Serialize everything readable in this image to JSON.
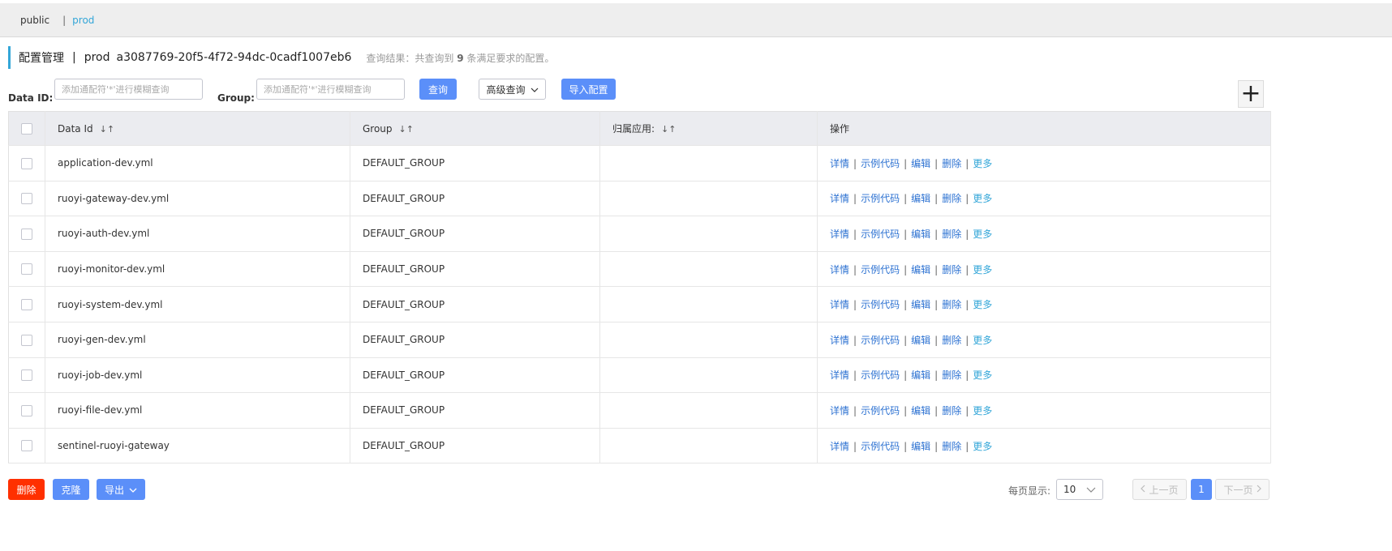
{
  "namespaces": {
    "items": [
      "public",
      "prod"
    ],
    "separator": "|",
    "active": "prod"
  },
  "title": {
    "main": "配置管理",
    "divider": "|",
    "namespace": "prod",
    "namespace_id": "a3087769-20f5-4f72-94dc-0cadf1007eb6",
    "result_prefix": "查询结果：共查询到",
    "result_count": "9",
    "result_suffix": "条满足要求的配置。"
  },
  "search": {
    "dataid_label": "Data ID:",
    "dataid_placeholder": "添加通配符'*'进行模糊查询",
    "group_label": "Group:",
    "group_placeholder": "添加通配符'*'进行模糊查询",
    "query_button": "查询",
    "advanced_button": "高级查询",
    "import_button": "导入配置",
    "add_button": "+"
  },
  "table": {
    "headers": [
      "Data Id",
      "Group",
      "归属应用:",
      "操作"
    ],
    "sort_icon": "↓↑",
    "rows": [
      {
        "data_id": "application-dev.yml",
        "group": "DEFAULT_GROUP",
        "app": ""
      },
      {
        "data_id": "ruoyi-gateway-dev.yml",
        "group": "DEFAULT_GROUP",
        "app": ""
      },
      {
        "data_id": "ruoyi-auth-dev.yml",
        "group": "DEFAULT_GROUP",
        "app": ""
      },
      {
        "data_id": "ruoyi-monitor-dev.yml",
        "group": "DEFAULT_GROUP",
        "app": ""
      },
      {
        "data_id": "ruoyi-system-dev.yml",
        "group": "DEFAULT_GROUP",
        "app": ""
      },
      {
        "data_id": "ruoyi-gen-dev.yml",
        "group": "DEFAULT_GROUP",
        "app": ""
      },
      {
        "data_id": "ruoyi-job-dev.yml",
        "group": "DEFAULT_GROUP",
        "app": ""
      },
      {
        "data_id": "ruoyi-file-dev.yml",
        "group": "DEFAULT_GROUP",
        "app": ""
      },
      {
        "data_id": "sentinel-ruoyi-gateway",
        "group": "DEFAULT_GROUP",
        "app": ""
      }
    ],
    "operations": [
      "详情",
      "示例代码",
      "编辑",
      "删除",
      "更多"
    ],
    "op_separator": "|"
  },
  "footer": {
    "delete_button": "删除",
    "clone_button": "克隆",
    "export_button": "导出",
    "page_size_label": "每页显示:",
    "page_size_value": "10",
    "prev_button": "上一页",
    "current_page": "1",
    "next_button": "下一页"
  },
  "colors": {
    "accent": "#33a6d8",
    "primary_button": "#5b8ff9",
    "danger_button": "#ff3000",
    "link": "#2d72d2"
  }
}
